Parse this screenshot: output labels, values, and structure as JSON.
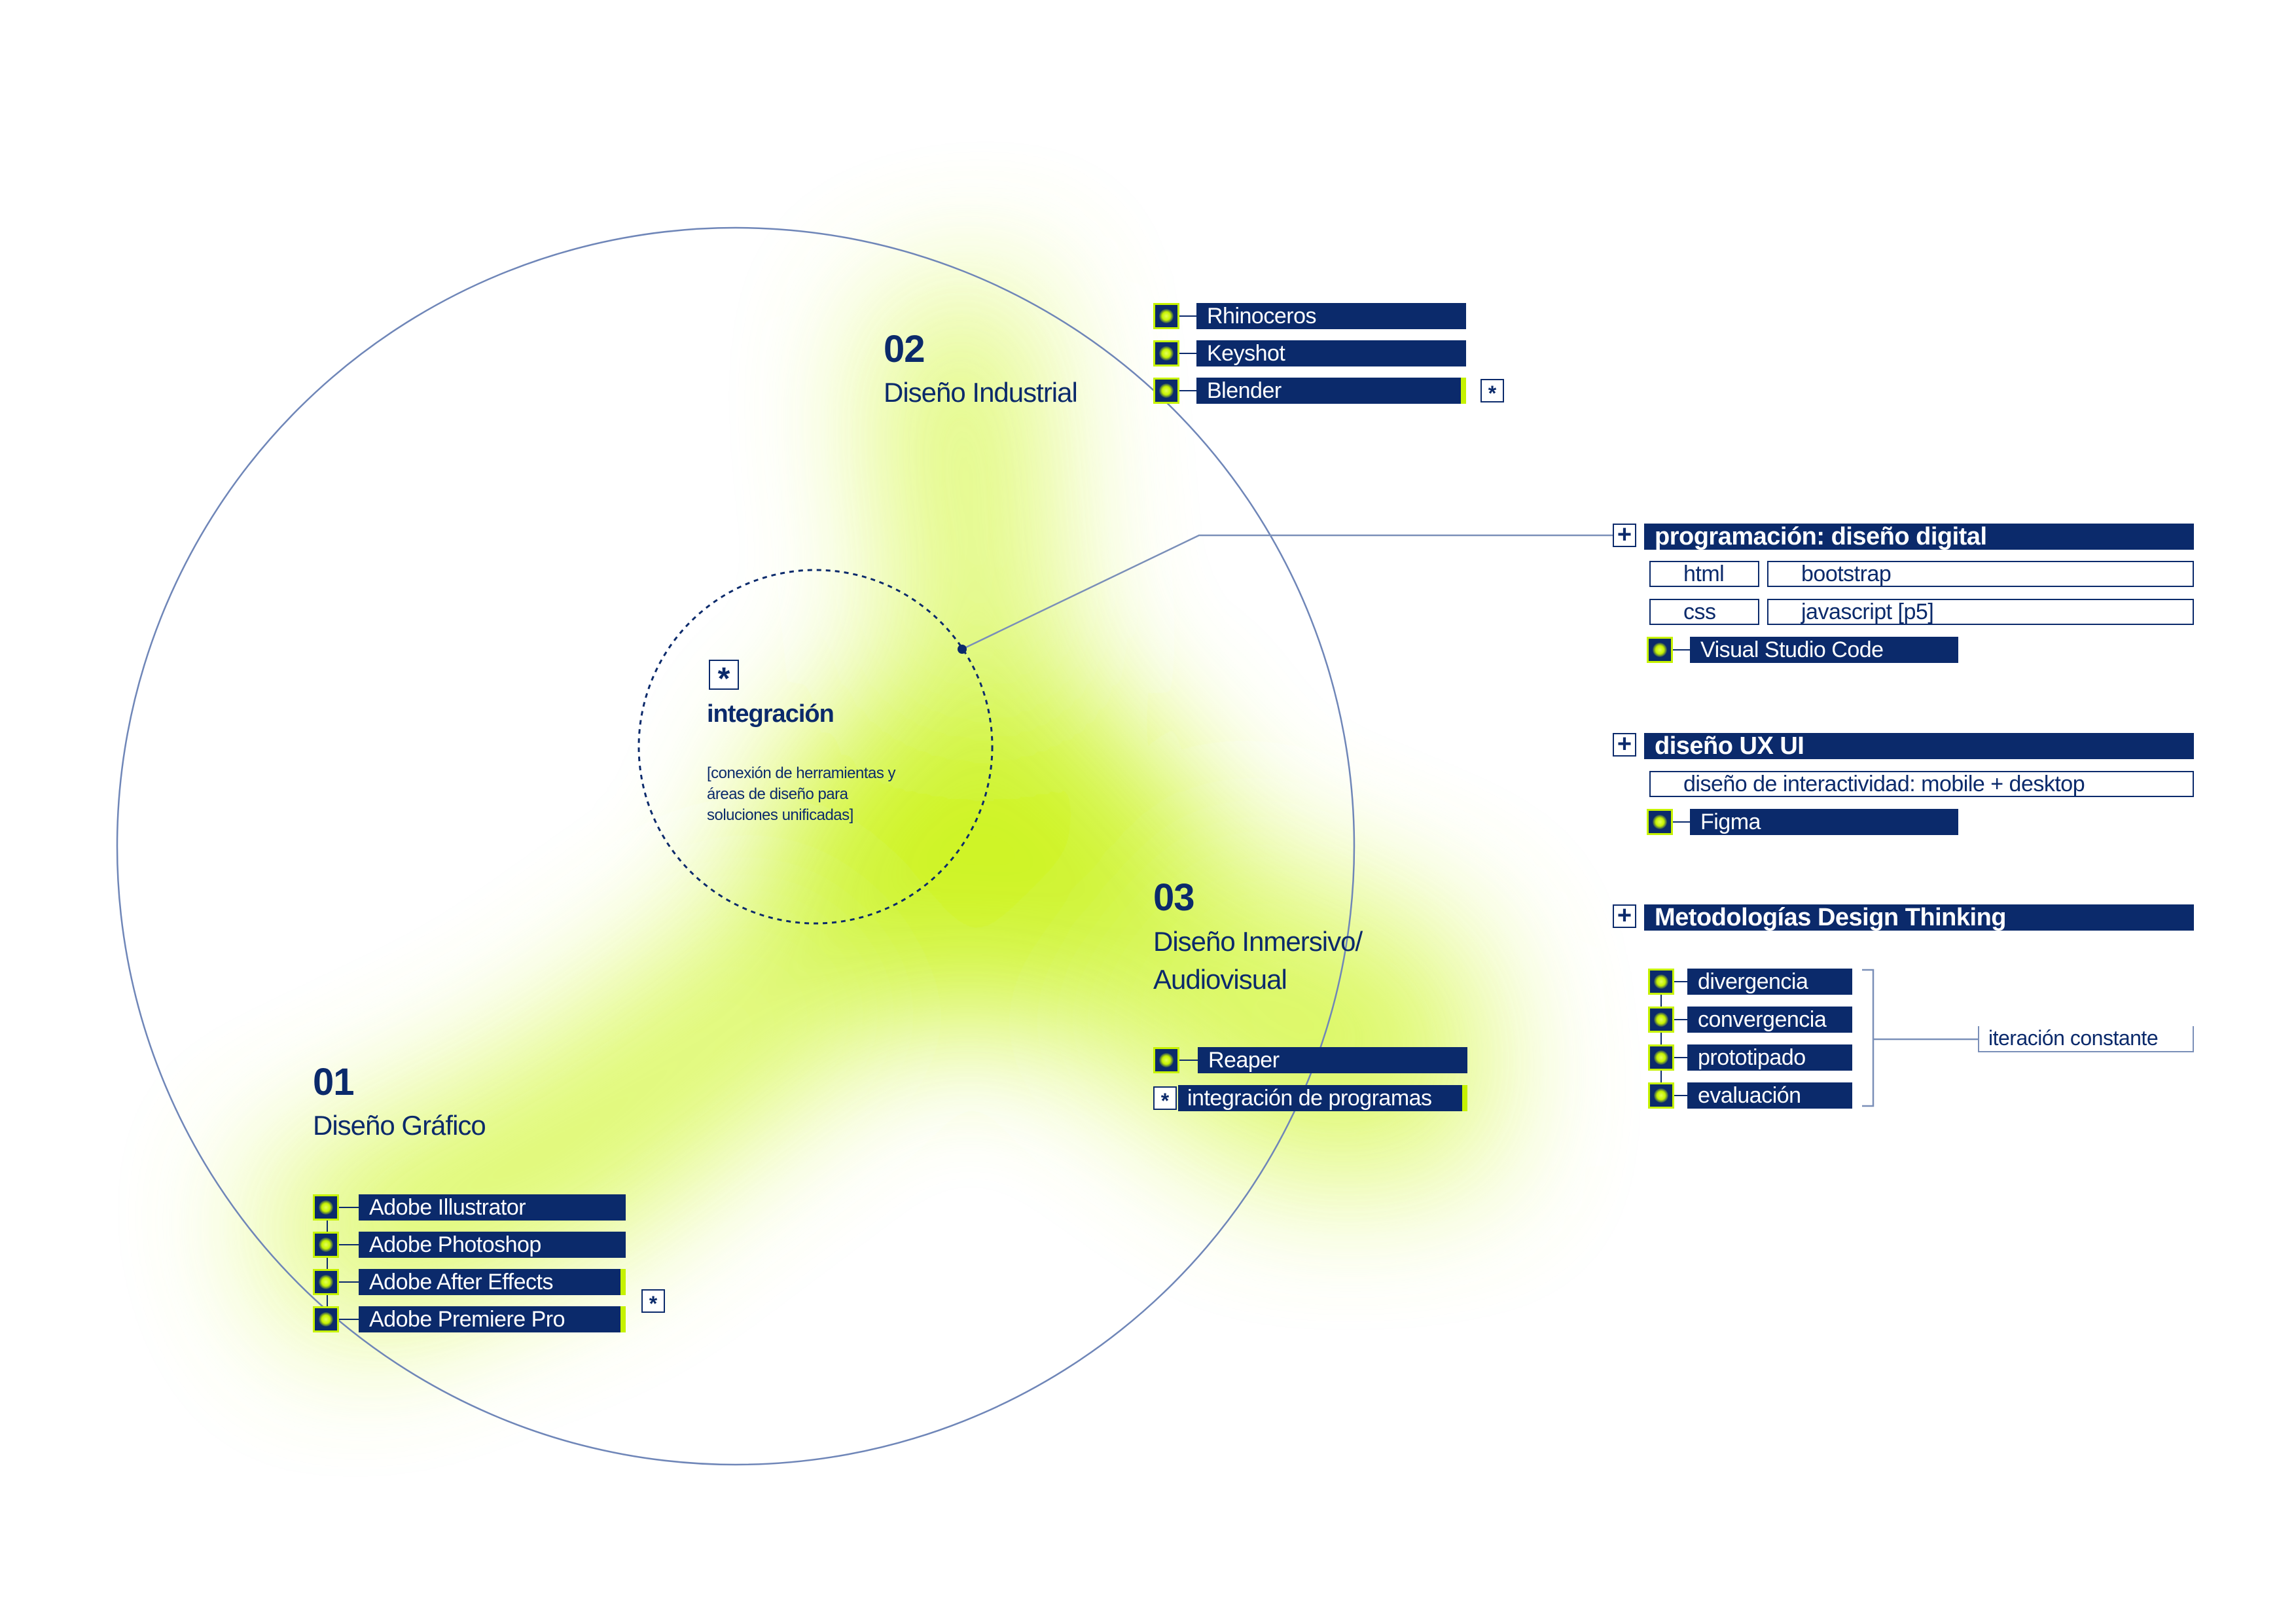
{
  "center": {
    "icon": "asterisk-icon",
    "title": "integración",
    "description": [
      "[conexión de herramientas y",
      "áreas de diseño para",
      "soluciones unificadas]"
    ]
  },
  "areas": {
    "grafico": {
      "number": "01",
      "name": "Diseño Gráfico",
      "tools": [
        "Adobe Illustrator",
        "Adobe Photoshop",
        "Adobe After Effects",
        "Adobe Premiere Pro"
      ]
    },
    "industrial": {
      "number": "02",
      "name": "Diseño Industrial",
      "tools": [
        "Rhinoceros",
        "Keyshot",
        "Blender"
      ]
    },
    "inmersivo": {
      "number": "03",
      "name_line1": "Diseño Inmersivo/",
      "name_line2": "Audiovisual",
      "tools": [
        "Reaper"
      ],
      "integration_label": "integración de programas"
    }
  },
  "programacion": {
    "title": "programación: diseño digital",
    "items": [
      "html",
      "bootstrap",
      "css",
      "javascript [p5]"
    ],
    "tool": "Visual Studio Code"
  },
  "ux": {
    "title": "diseño UX UI",
    "item": "diseño de interactividad: mobile + desktop",
    "tool": "Figma"
  },
  "design_thinking": {
    "title": "Metodologías Design Thinking",
    "steps": [
      "divergencia",
      "convergencia",
      "prototipado",
      "evaluación"
    ],
    "iteration": "iteración constante"
  },
  "symbols": {
    "plus": "+",
    "star": "*"
  },
  "colors": {
    "navy": "#0b2a6b",
    "lime": "#c6f200",
    "line": "#7a8fb8"
  }
}
